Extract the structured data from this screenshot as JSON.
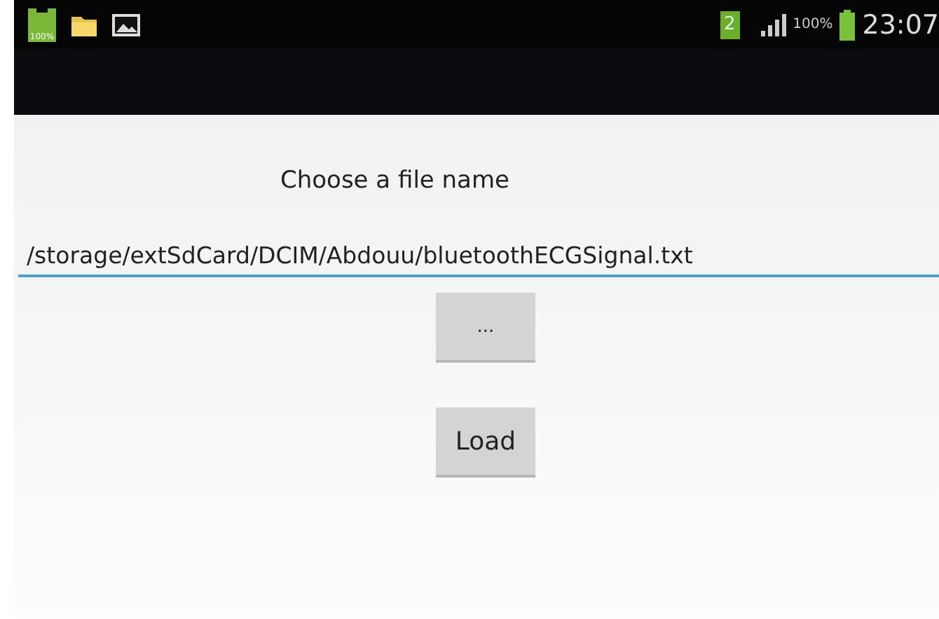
{
  "status_bar": {
    "battery_badge": "100%",
    "sim_slot": "2",
    "battery_percent": "100%",
    "time": "23:07"
  },
  "form": {
    "title": "Choose a file name",
    "file_field": {
      "value": "/storage/extSdCard/DCIM/Abdouu/bluetoothECGSignal.txt"
    }
  },
  "buttons": [
    {
      "label": "...",
      "kind": "browse"
    },
    {
      "label": "Load",
      "kind": "load"
    }
  ]
}
